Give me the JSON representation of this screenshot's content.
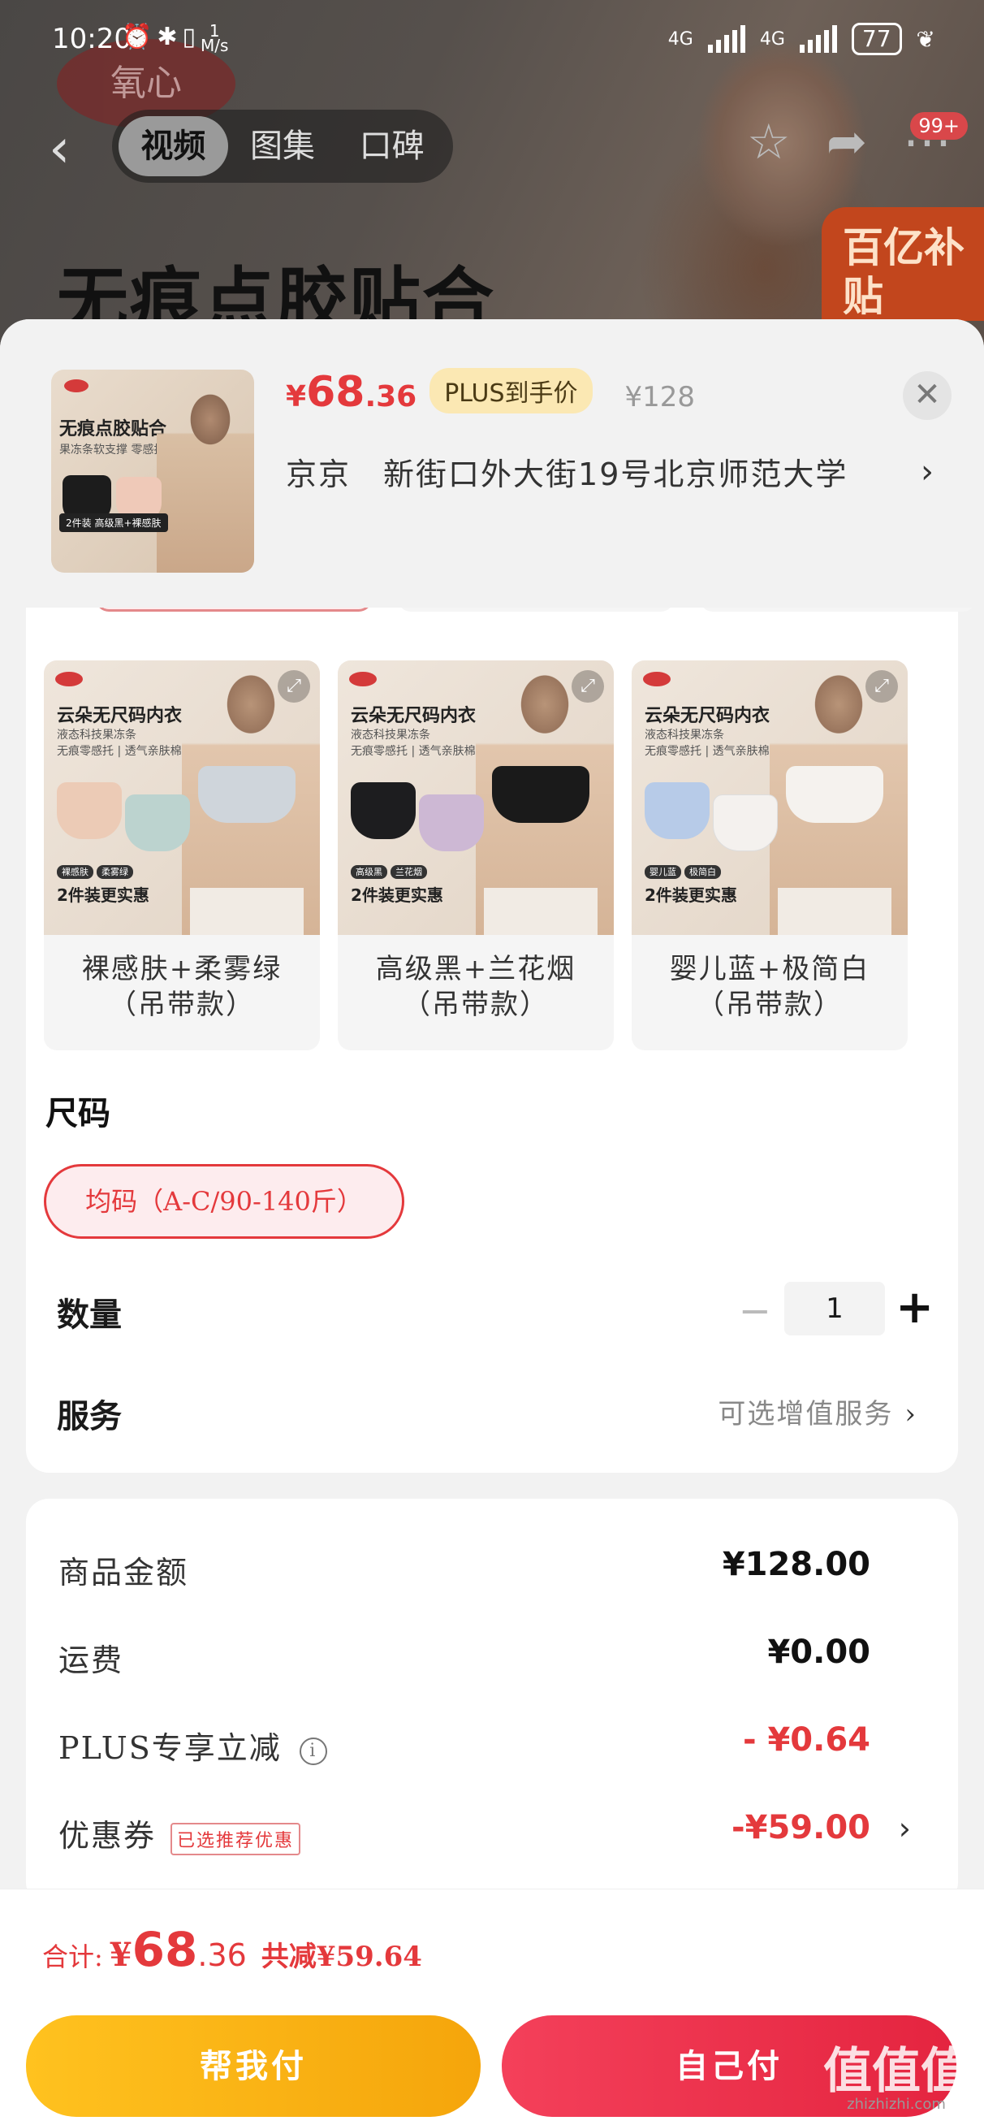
{
  "status_bar": {
    "time": "10:20",
    "net_speed_value": "1",
    "net_speed_unit": "M/s",
    "net1": "4G",
    "net2": "4G",
    "battery": "77"
  },
  "background": {
    "brand_logo": "氧心",
    "headline": "无痕点胶贴合",
    "badge": "百亿补贴",
    "nav_tabs": [
      "视频",
      "图集",
      "口碑"
    ],
    "notification_badge": "99+"
  },
  "product": {
    "price_currency": "¥",
    "price_int": "68",
    "price_dec": ".36",
    "plus_tag": "PLUS到手价",
    "original_price": "¥128",
    "thumb_title": "无痕点胶贴合",
    "thumb_sub": "果冻条软支撑 零感托",
    "thumb_footer": "2件装 高级黑+裸感肤",
    "close_glyph": "✕"
  },
  "address": {
    "city": "京京",
    "street": "新街口外大街19号北京师范大学"
  },
  "colors": [
    {
      "label_line1": "裸感肤+柔雾绿",
      "label_line2": "（吊带款）",
      "img_title": "云朵无尺码内衣",
      "img_sub1": "液态科技果冻条",
      "img_sub2": "无痕零感托 | 透气亲肤棉",
      "pill1": "裸感肤",
      "pill2": "柔雾绿",
      "img_tag": "2件装更实惠",
      "bra1": "#eccbb6",
      "bra2": "#bcd3cf",
      "model_bra": "#cfd5db"
    },
    {
      "label_line1": "高级黑+兰花烟",
      "label_line2": "（吊带款）",
      "img_title": "云朵无尺码内衣",
      "img_sub1": "液态科技果冻条",
      "img_sub2": "无痕零感托 | 透气亲肤棉",
      "pill1": "高级黑",
      "pill2": "兰花烟",
      "img_tag": "2件装更实惠",
      "bra1": "#1d1d1f",
      "bra2": "#cdb8d4",
      "model_bra": "#1a1a1a"
    },
    {
      "label_line1": "婴儿蓝+极简白",
      "label_line2": "（吊带款）",
      "img_title": "云朵无尺码内衣",
      "img_sub1": "液态科技果冻条",
      "img_sub2": "无痕零感托 | 透气亲肤棉",
      "pill1": "婴儿蓝",
      "pill2": "极简白",
      "img_tag": "2件装更实惠",
      "bra1": "#b7cbe8",
      "bra2": "#f4f1ee",
      "model_bra": "#f5f2ee"
    }
  ],
  "size": {
    "title": "尺码",
    "selected": "均码（A-C/90-140斤）"
  },
  "quantity": {
    "label": "数量",
    "minus": "−",
    "value": "1",
    "plus": "+"
  },
  "service": {
    "label": "服务",
    "value": "可选增值服务"
  },
  "price_detail": {
    "rows": [
      {
        "label": "商品金额",
        "value": "¥128.00"
      },
      {
        "label": "运费",
        "value": "¥0.00"
      },
      {
        "label": "PLUS专享立减",
        "value": "- ¥0.64",
        "info": "i"
      },
      {
        "label": "优惠券",
        "value": "-¥59.00",
        "tag": "已选推荐优惠"
      }
    ]
  },
  "footer": {
    "total_label": "合计:",
    "total_currency": "¥",
    "total_int": "68",
    "total_dec": ".36",
    "total_save": "共减¥59.64",
    "btn_help": "帮我付",
    "btn_self": "自己付",
    "watermark": "值值值",
    "watermark_url": "zhizhizhi.com"
  },
  "colors_theme": {
    "accent_red": "#e4393c",
    "plus_gold": "#fbe8b3",
    "help_btn": "#ffc21f",
    "self_btn": "#f4405a"
  }
}
